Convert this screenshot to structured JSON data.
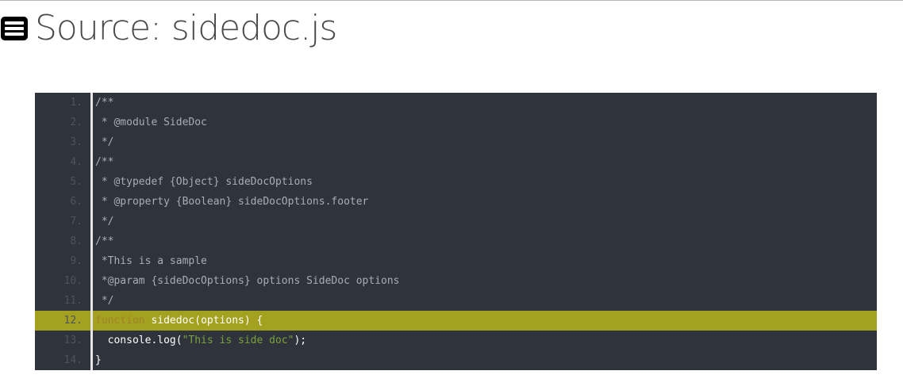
{
  "header": {
    "menu_icon": "hamburger-menu-icon",
    "title": "Source: sidedoc.js"
  },
  "colors": {
    "code_background": "#2f333b",
    "highlight_line": "#a3a11f",
    "string": "#79a33a",
    "keyword": "#c9a23a",
    "comment": "#a8aeb5"
  },
  "code": {
    "highlighted_line": 12,
    "lines": [
      {
        "num": "1.",
        "text": "/**"
      },
      {
        "num": "2.",
        "text": " * @module SideDoc"
      },
      {
        "num": "3.",
        "text": " */"
      },
      {
        "num": "4.",
        "text": "/**"
      },
      {
        "num": "5.",
        "text": " * @typedef {Object} sideDocOptions"
      },
      {
        "num": "6.",
        "text": " * @property {Boolean} sideDocOptions.footer"
      },
      {
        "num": "7.",
        "text": " */"
      },
      {
        "num": "8.",
        "text": "/**"
      },
      {
        "num": "9.",
        "text": " *This is a sample"
      },
      {
        "num": "10.",
        "text": " *@param {sideDocOptions} options SideDoc options"
      },
      {
        "num": "11.",
        "text": " */"
      },
      {
        "num": "12.",
        "kw": "function",
        "rest": " sidedoc(options) {"
      },
      {
        "num": "13.",
        "pre": "  console.log(",
        "str": "\"This is side doc\"",
        "post": ");"
      },
      {
        "num": "14.",
        "text": "}"
      }
    ]
  }
}
